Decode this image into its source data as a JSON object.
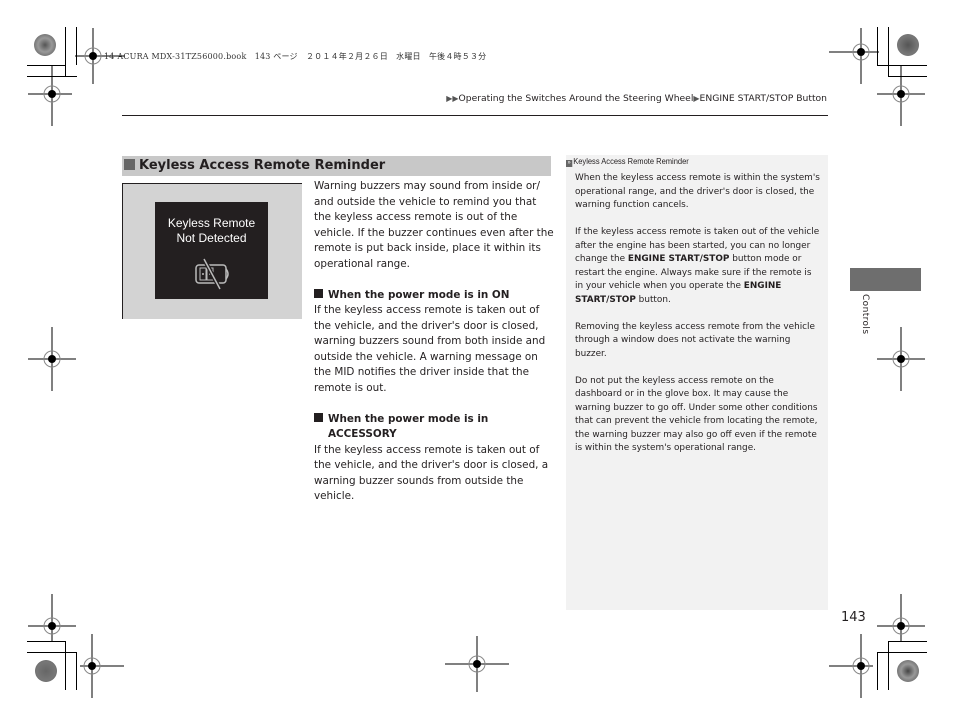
{
  "print_meta": {
    "text": "14 ACURA MDX-31TZ56000.book　143 ページ　２０１４年２月２６日　水曜日　午後４時５３分"
  },
  "breadcrumb": {
    "items": [
      "Operating the Switches Around the Steering Wheel",
      "ENGINE START/STOP Button"
    ]
  },
  "section": {
    "title": "Keyless Access Remote Reminder",
    "display": {
      "line1": "Keyless Remote",
      "line2": "Not Detected",
      "icon": "key-fob-crossed-icon"
    },
    "intro": "Warning buzzers may sound from inside or/ and outside the vehicle to remind you that the keyless access remote is out of the vehicle. If the buzzer continues even after the remote is put back inside, place it within its operational range.",
    "subsections": [
      {
        "heading": "When the power mode is in ON",
        "body": "If the keyless access remote is taken out of the vehicle, and the driver's door is closed, warning buzzers sound from both inside and outside the vehicle. A warning message on the MID notifies the driver inside that the remote is out."
      },
      {
        "heading_line1": "When the power mode is in",
        "heading_line2": "ACCESSORY",
        "body": "If the keyless access remote is taken out of the vehicle, and the driver's door is closed, a warning buzzer sounds from outside the vehicle."
      }
    ]
  },
  "sidebar": {
    "title": "Keyless Access Remote Reminder",
    "p1": "When the keyless access remote is within the system's operational range, and the driver's door is closed, the warning function cancels.",
    "p2_a": "If the keyless access remote is taken out of the vehicle after the engine has been started, you can no longer change the ",
    "p2_b": "ENGINE START/STOP",
    "p2_c": " button mode or restart the engine. Always make sure if the remote is in your vehicle when you operate the ",
    "p2_d": "ENGINE START/STOP",
    "p2_e": " button.",
    "p3": "Removing the keyless access remote from the vehicle through a window does not activate the warning buzzer.",
    "p4": "Do not put the keyless access remote on the dashboard or in the glove box. It may cause the warning buzzer to go off. Under some other conditions that can prevent the vehicle from locating the remote, the warning buzzer may also go off even if the remote is within the system's operational range."
  },
  "chapter_tab": {
    "label": "Controls"
  },
  "page_number": "143"
}
